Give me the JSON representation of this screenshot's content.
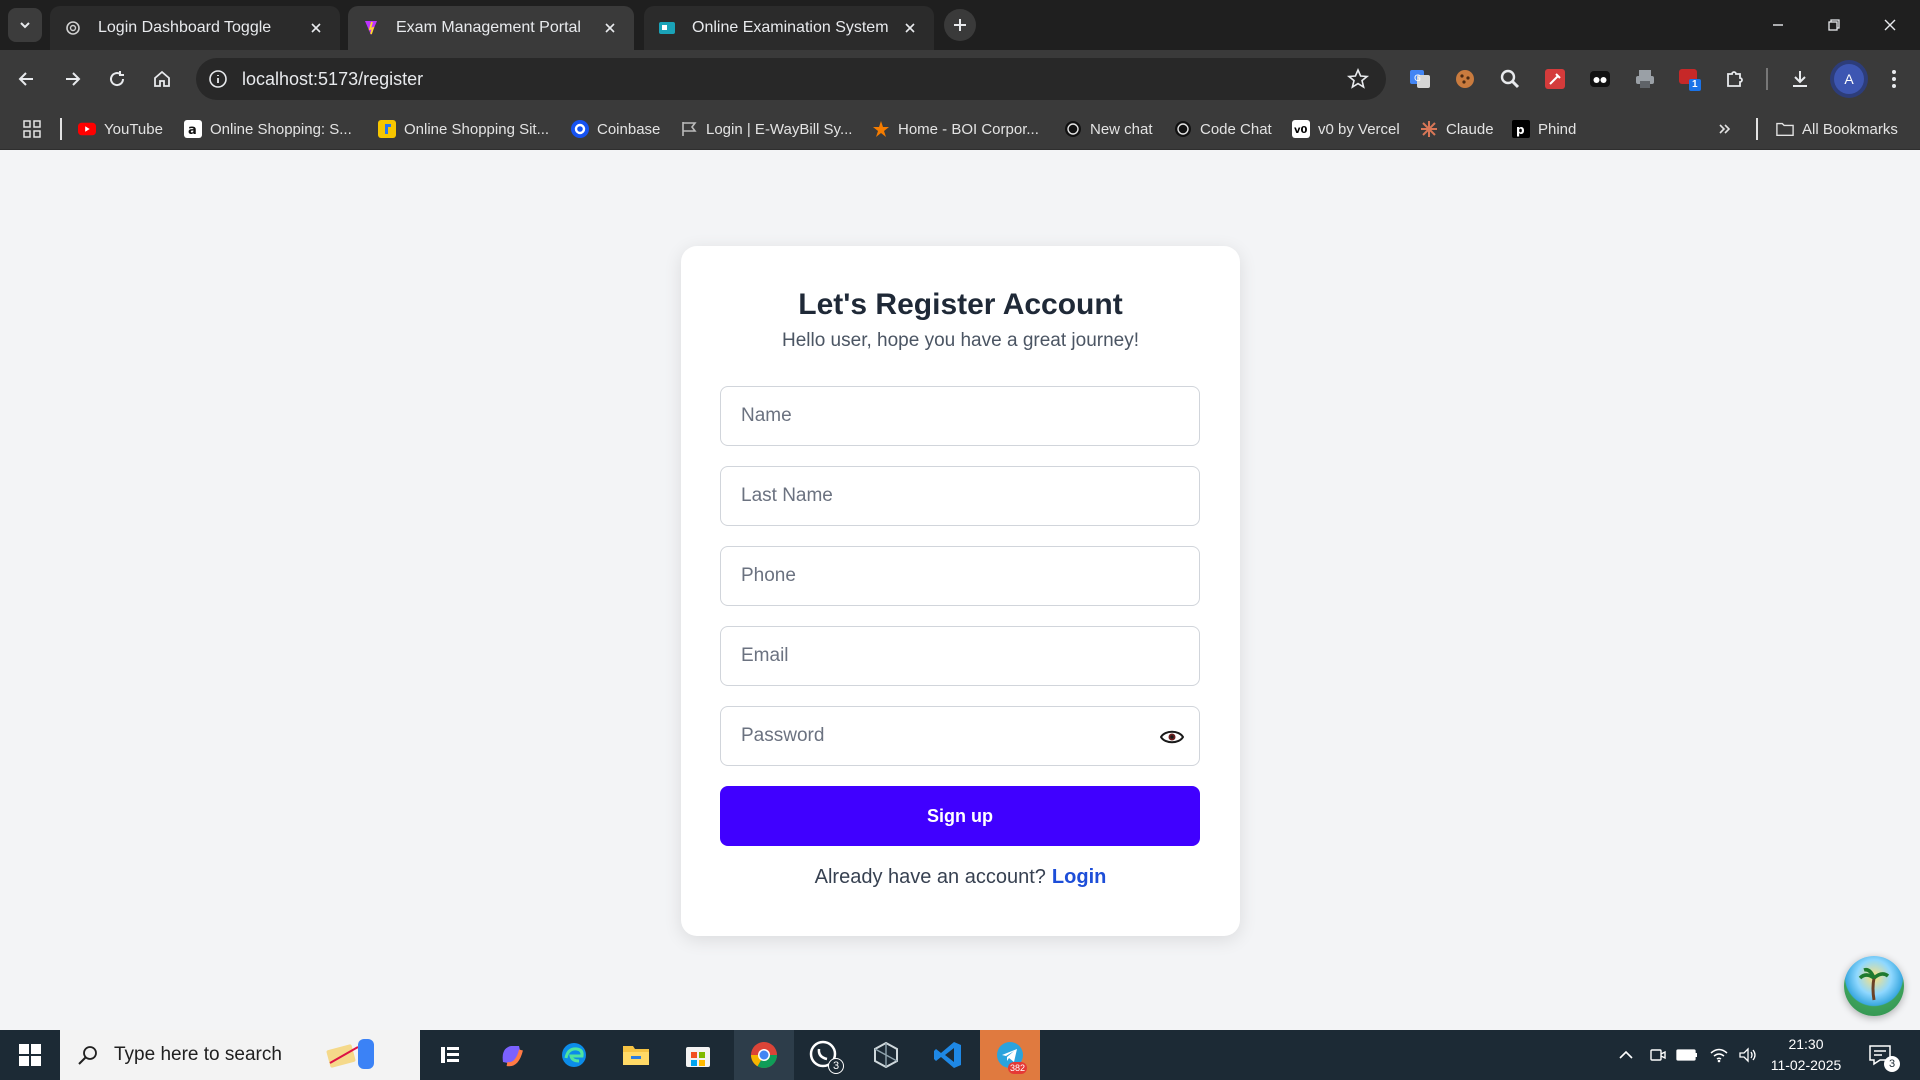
{
  "browser": {
    "tabs": [
      {
        "title": "Login Dashboard Toggle",
        "favicon": "chatgpt-icon"
      },
      {
        "title": "Exam Management Portal",
        "favicon": "vite-icon"
      },
      {
        "title": "Online Examination System Insi",
        "favicon": "site-icon"
      }
    ],
    "url": "localhost:5173/register",
    "profile_initial": "A",
    "extension_badge": "1",
    "bookmarks": [
      {
        "label": "YouTube",
        "icon": "youtube-icon"
      },
      {
        "label": "Online Shopping: S...",
        "icon": "amazon-icon"
      },
      {
        "label": "Online Shopping Sit...",
        "icon": "flipkart-icon"
      },
      {
        "label": "Coinbase",
        "icon": "coinbase-icon"
      },
      {
        "label": "Login | E-WayBill Sy...",
        "icon": "ewaybill-icon"
      },
      {
        "label": "Home - BOI Corpor...",
        "icon": "boi-icon"
      },
      {
        "label": "New chat",
        "icon": "chatgpt-icon"
      },
      {
        "label": "Code Chat",
        "icon": "chatgpt-icon"
      },
      {
        "label": "v0 by Vercel",
        "icon": "v0-icon"
      },
      {
        "label": "Claude",
        "icon": "claude-icon"
      },
      {
        "label": "Phind",
        "icon": "phind-icon"
      }
    ],
    "all_bookmarks_label": "All Bookmarks"
  },
  "register": {
    "title": "Let's Register Account",
    "subtitle": "Hello user, hope you have a great journey!",
    "name_placeholder": "Name",
    "last_name_placeholder": "Last Name",
    "phone_placeholder": "Phone",
    "email_placeholder": "Email",
    "password_placeholder": "Password",
    "signup_label": "Sign up",
    "already_text": "Already have an account?",
    "login_link": "Login",
    "accent_color": "#4000ff"
  },
  "taskbar": {
    "search_placeholder": "Type here to search",
    "time": "21:30",
    "date": "11-02-2025",
    "whatsapp_badge": "3",
    "telegram_badge": "382",
    "notification_count": "3"
  }
}
